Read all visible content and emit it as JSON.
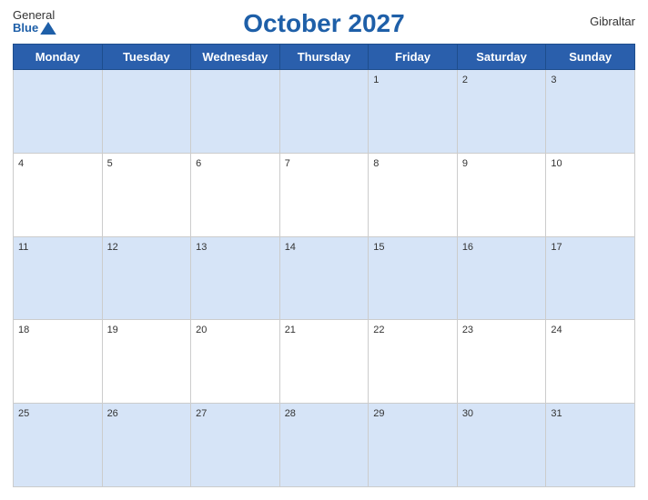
{
  "header": {
    "title": "October 2027",
    "country": "Gibraltar",
    "logo_general": "General",
    "logo_blue": "Blue"
  },
  "weekdays": [
    "Monday",
    "Tuesday",
    "Wednesday",
    "Thursday",
    "Friday",
    "Saturday",
    "Sunday"
  ],
  "weeks": [
    [
      null,
      null,
      null,
      null,
      1,
      2,
      3
    ],
    [
      4,
      5,
      6,
      7,
      8,
      9,
      10
    ],
    [
      11,
      12,
      13,
      14,
      15,
      16,
      17
    ],
    [
      18,
      19,
      20,
      21,
      22,
      23,
      24
    ],
    [
      25,
      26,
      27,
      28,
      29,
      30,
      31
    ]
  ]
}
